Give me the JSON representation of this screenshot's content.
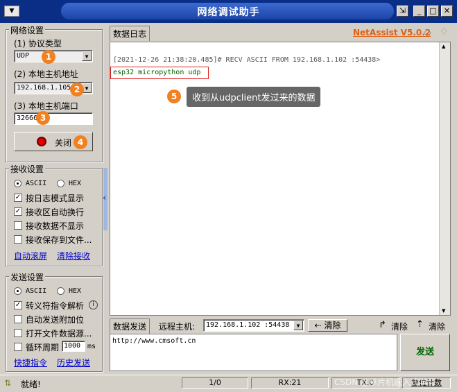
{
  "window": {
    "title": "网络调试助手"
  },
  "net_settings": {
    "group_title": "网络设置",
    "protocol_label": "(1) 协议类型",
    "protocol_value": "UDP",
    "host_label": "(2) 本地主机地址",
    "host_value": "192.168.1.105",
    "port_label": "(3) 本地主机端口",
    "port_value": "32666",
    "close_button": "关闭"
  },
  "badges": [
    "1",
    "2",
    "3",
    "4",
    "5"
  ],
  "recv_settings": {
    "group_title": "接收设置",
    "ascii": "ASCII",
    "hex": "HEX",
    "opt1": "按日志模式显示",
    "opt2": "接收区自动换行",
    "opt3": "接收数据不显示",
    "opt4": "接收保存到文件...",
    "link_autoscroll": "自动滚屏",
    "link_clear": "清除接收"
  },
  "send_settings": {
    "group_title": "发送设置",
    "ascii": "ASCII",
    "hex": "HEX",
    "opt1": "转义符指令解析",
    "opt2": "自动发送附加位",
    "opt3": "打开文件数据源...",
    "opt4": "循环周期",
    "cycle_value": "1000",
    "cycle_unit": "ms",
    "link_shortcut": "快捷指令",
    "link_history": "历史发送"
  },
  "log": {
    "tab": "数据日志",
    "brand": "NetAssist V5.0.2",
    "line1": "[2021-12-26 21:38:20.485]# RECV ASCII FROM 192.168.1.102 :54438>",
    "line2": "esp32 micropython udp",
    "annotation": "收到从udpclient发过来的数据"
  },
  "send": {
    "tab": "数据发送",
    "remote_label": "远程主机:",
    "remote_value": "192.168.1.102 :54438",
    "clear_button": "清除",
    "clear1": "清除",
    "clear2": "清除",
    "input_value": "http://www.cmsoft.cn",
    "send_button": "发送"
  },
  "status": {
    "text": "就绪!",
    "count": "1/0",
    "rx": "RX:21",
    "tx": "TX:0",
    "reset": "复位计数",
    "watermark": "CSDN @单片机嵌入式学习"
  },
  "colors": {
    "accent": "#f08020",
    "link": "#0000cc",
    "brand": "#e06010",
    "log_text": "#006400"
  }
}
